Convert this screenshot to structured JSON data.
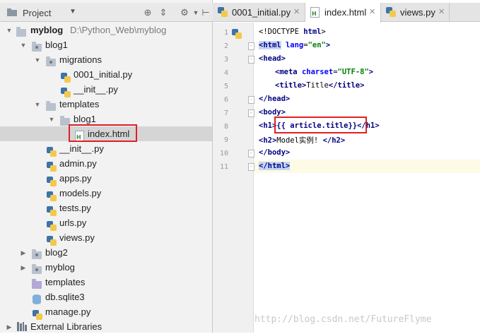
{
  "panel": {
    "title": "Project",
    "dropdown_icon": "chevron-down-icon"
  },
  "tree": [
    {
      "label": "myblog",
      "path": "D:\\Python_Web\\myblog",
      "bold": true
    },
    {
      "label": "blog1"
    },
    {
      "label": "migrations"
    },
    {
      "label": "0001_initial.py"
    },
    {
      "label": "__init__.py"
    },
    {
      "label": "templates"
    },
    {
      "label": "blog1"
    },
    {
      "label": "index.html",
      "selected": true
    },
    {
      "label": "__init__.py"
    },
    {
      "label": "admin.py"
    },
    {
      "label": "apps.py"
    },
    {
      "label": "models.py"
    },
    {
      "label": "tests.py"
    },
    {
      "label": "urls.py"
    },
    {
      "label": "views.py"
    },
    {
      "label": "blog2"
    },
    {
      "label": "myblog"
    },
    {
      "label": "templates"
    },
    {
      "label": "db.sqlite3"
    },
    {
      "label": "manage.py"
    },
    {
      "label": "External Libraries"
    }
  ],
  "tabs": [
    {
      "label": "0001_initial.py"
    },
    {
      "label": "index.html",
      "active": true
    },
    {
      "label": "views.py"
    }
  ],
  "editor": {
    "line_numbers": [
      "1",
      "2",
      "3",
      "4",
      "5",
      "6",
      "7",
      "8",
      "9",
      "10",
      "11"
    ],
    "lines": {
      "l1_text": "<!DOCTYPE ",
      "l1_kw": "html",
      "l1_end": ">",
      "l2_open": "<",
      "l2_tag": "html",
      "l2_attr": " lang",
      "l2_eq": "=",
      "l2_val": "\"en\"",
      "l2_close": ">",
      "l3": "<head>",
      "l4_open": "<meta ",
      "l4_attr": "charset",
      "l4_eq": "=",
      "l4_val": "\"UTF-8\"",
      "l4_close": ">",
      "l5_open": "<title>",
      "l5_text": "Title",
      "l5_close": "</title>",
      "l6": "</head>",
      "l7": "<body>",
      "l8_open": "<h1>",
      "l8_tmpl": "{{ article.title}}",
      "l8_close": "</h1>",
      "l9_open": "<h2>",
      "l9_text": "Model实例! ",
      "l9_close": "</h2>",
      "l10": "</body>",
      "l11": "</html>"
    }
  },
  "watermark": "http://blog.csdn.net/FutureFlyme",
  "colors": {
    "highlight_box": "#e02020",
    "selected_row": "#d5d5d5"
  }
}
